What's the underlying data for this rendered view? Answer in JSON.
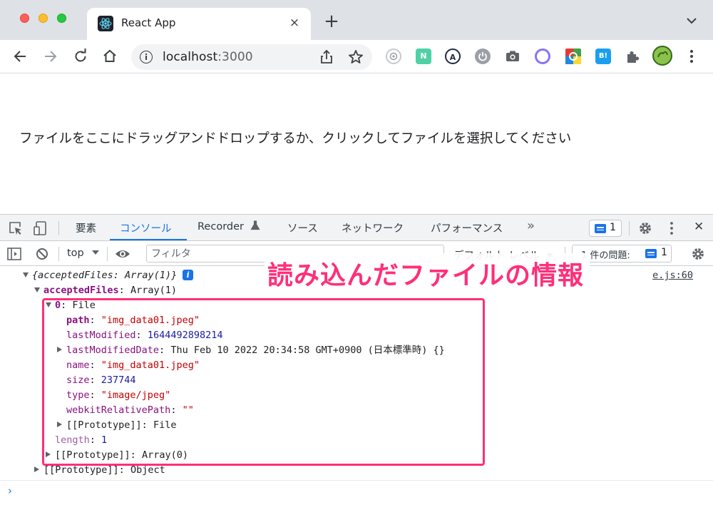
{
  "browser": {
    "tab_title": "React App",
    "tab_close": "×",
    "new_tab": "+",
    "url_host": "localhost",
    "url_port": ":3000"
  },
  "page": {
    "dropzone_text": "ファイルをここにドラッグアンドドロップするか、クリックしてファイルを選択してください"
  },
  "devtools": {
    "tabs": [
      {
        "label": "要素"
      },
      {
        "label": "コンソール"
      },
      {
        "label": "Recorder"
      },
      {
        "label": "ソース"
      },
      {
        "label": "ネットワーク"
      },
      {
        "label": "パフォーマンス"
      }
    ],
    "more_tabs": "»",
    "issues_badge_count": "1",
    "close": "✕",
    "filter": {
      "context": "top",
      "placeholder": "フィルタ",
      "level": "デフォルト レベル",
      "issues_label": "1 件の問題:",
      "issues_count": "1"
    },
    "console": {
      "source_link": "e.js:60",
      "lines": {
        "root": "{acceptedFiles: Array(1)}",
        "accepted_key": "acceptedFiles",
        "accepted_val": "Array(1)",
        "item_index": "0",
        "item_type": "File",
        "path_key": "path",
        "path_val": "\"img_data01.jpeg\"",
        "lastmod_key": "lastModified",
        "lastmod_val": "1644492898214",
        "lastmoddate_key": "lastModifiedDate",
        "lastmoddate_val": "Thu Feb 10 2022 20:34:58 GMT+0900 (日本標準時) {}",
        "name_key": "name",
        "name_val": "\"img_data01.jpeg\"",
        "size_key": "size",
        "size_val": "237744",
        "type_key": "type",
        "type_val": "\"image/jpeg\"",
        "webkit_key": "webkitRelativePath",
        "webkit_val": "\"\"",
        "proto_file_key": "[[Prototype]]",
        "proto_file_val": "File",
        "length_key": "length",
        "length_val": "1",
        "proto_arr_key": "[[Prototype]]",
        "proto_arr_val": "Array(0)",
        "proto_obj_key": "[[Prototype]]",
        "proto_obj_val": "Object"
      },
      "prompt": "›"
    }
  },
  "annotation": {
    "title": "読み込んだファイルの情報",
    "color": "#ff2f79"
  }
}
